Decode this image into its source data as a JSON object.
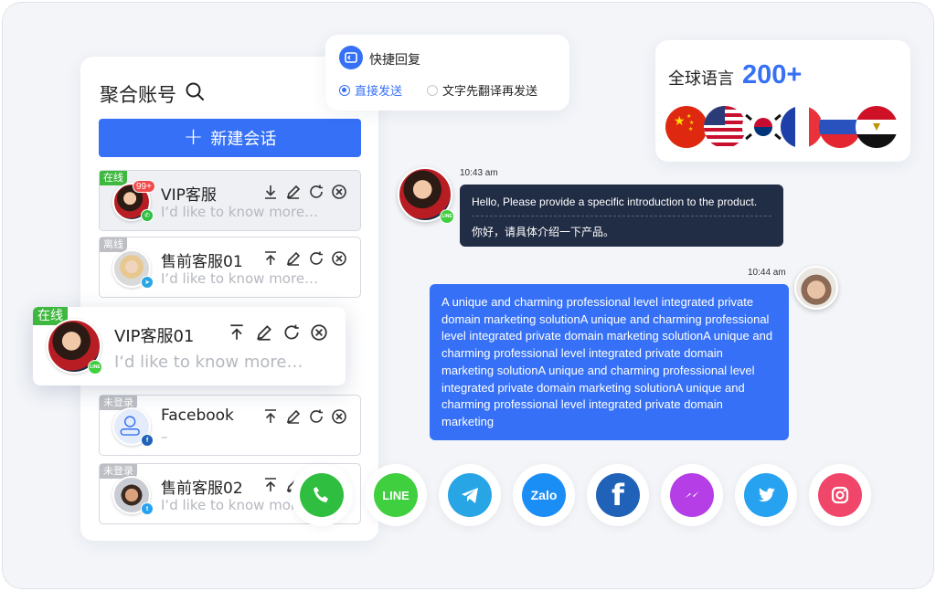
{
  "panel": {
    "title": "聚合账号",
    "new_button": "新建会话"
  },
  "sessions": [
    {
      "tag": "在线",
      "name": "VIP客服",
      "message": "I‘d like to know more…",
      "unread": "99+",
      "channel": "whatsapp-icon"
    },
    {
      "tag": "离线",
      "name": "售前客服01",
      "message": "I‘d like to know more…",
      "channel": "telegram-icon"
    },
    {
      "tag": "在线",
      "name": "VIP客服01",
      "message": "I‘d like to know more…",
      "channel": "line-icon"
    },
    {
      "tag": "未登录",
      "name": "Facebook",
      "message": "–",
      "channel": "facebook-icon"
    },
    {
      "tag": "未登录",
      "name": "售前客服02",
      "message": "I‘d like to know more…",
      "channel": "twitter-icon"
    }
  ],
  "quick_reply": {
    "title": "快捷回复",
    "option_direct": "直接发送",
    "option_translate": "文字先翻译再发送",
    "selected": "直接发送"
  },
  "languages": {
    "label": "全球语言",
    "count": "200+",
    "flags": [
      "china-flag-icon",
      "usa-flag-icon",
      "korea-flag-icon",
      "france-flag-icon",
      "russia-flag-icon",
      "egypt-flag-icon"
    ]
  },
  "chat": {
    "incoming": {
      "time": "10:43 am",
      "text_en": "Hello, Please provide a specific introduction to the product.",
      "text_zh": "你好，请具体介绍一下产品。"
    },
    "outgoing": {
      "time": "10:44 am",
      "text": "A unique and charming professional level integrated private domain marketing solutionA unique and charming professional level integrated private domain marketing solutionA unique and charming professional level integrated private domain marketing solutionA unique and charming professional level integrated private domain marketing solutionA unique and charming professional level integrated private domain marketing"
    }
  },
  "apps": [
    {
      "name": "phone-icon",
      "color": "#2fbe3f"
    },
    {
      "name": "line-icon",
      "label": "LINE",
      "color": "#3fcf3f"
    },
    {
      "name": "telegram-icon",
      "color": "#27a5e5"
    },
    {
      "name": "zalo-icon",
      "label": "Zalo",
      "color": "#1b8ef5"
    },
    {
      "name": "facebook-icon",
      "color": "#1f62b8"
    },
    {
      "name": "messenger-icon",
      "color": "#b53ee6"
    },
    {
      "name": "twitter-icon",
      "color": "#26a2f0"
    },
    {
      "name": "instagram-icon",
      "color": "#f0466a"
    }
  ],
  "colors": {
    "accent": "#3570f6",
    "online": "#3fb83f",
    "offline": "#bdbfc4",
    "dark_bubble": "#212c45"
  }
}
